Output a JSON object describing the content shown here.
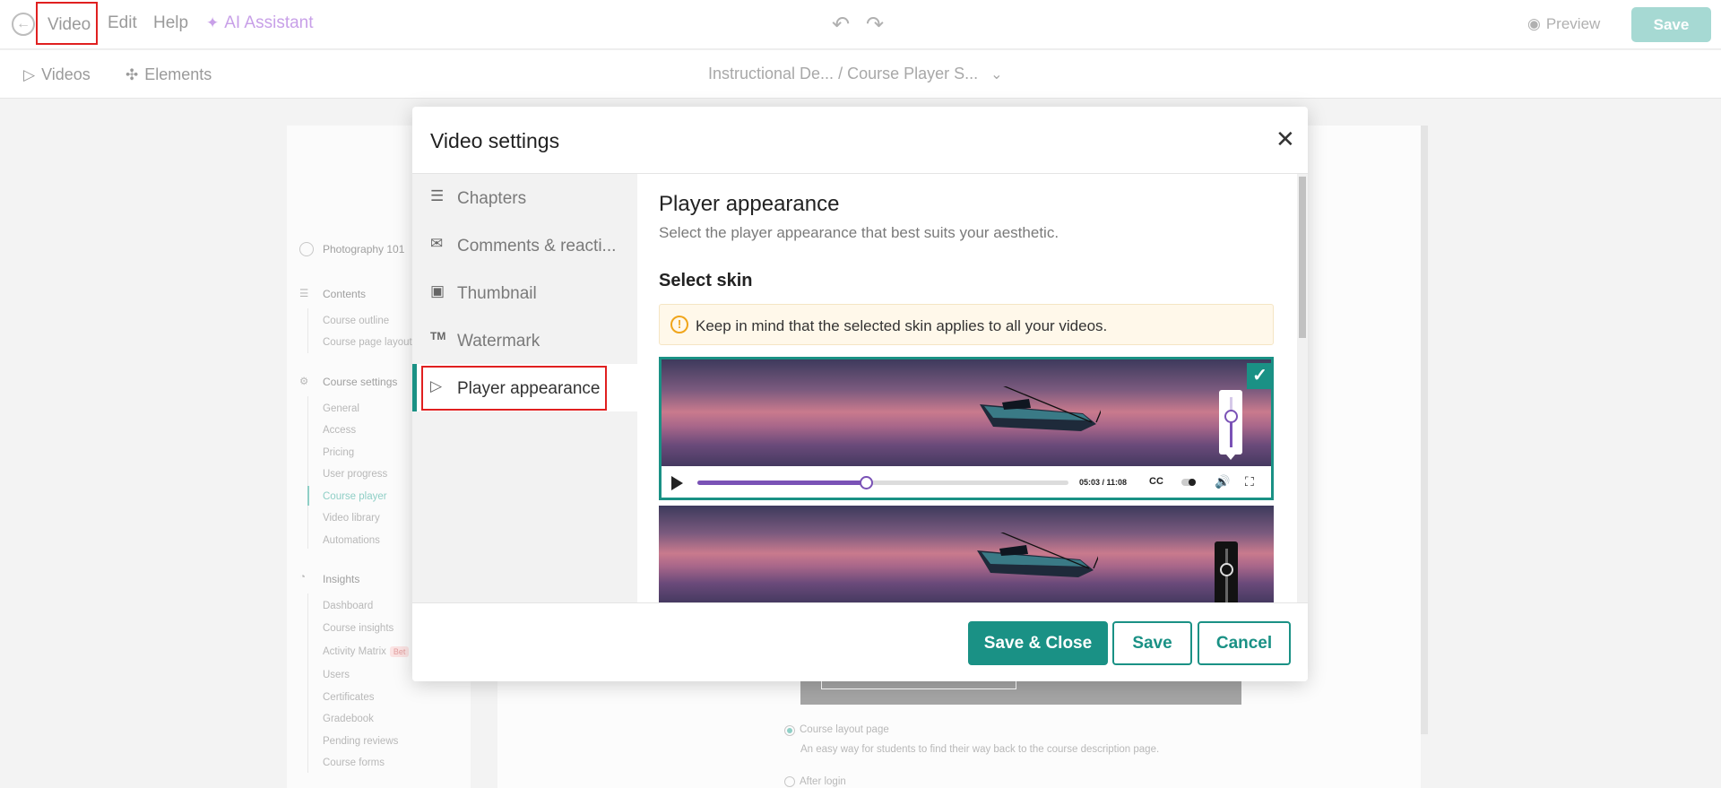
{
  "topbar": {
    "menu": {
      "video": "Video",
      "edit": "Edit",
      "help": "Help",
      "ai": "AI Assistant"
    },
    "preview_label": "Preview",
    "save_label": "Save"
  },
  "subbar": {
    "tab_videos": "Videos",
    "tab_elements": "Elements",
    "breadcrumb": "Instructional De...  / Course Player S..."
  },
  "background": {
    "course_title": "Photography 101",
    "contents_heading": "Contents",
    "contents_items": [
      "Course outline",
      "Course page layout"
    ],
    "settings_heading": "Course settings",
    "settings_items": [
      "General",
      "Access",
      "Pricing",
      "User progress",
      "Course player",
      "Video library",
      "Automations"
    ],
    "active_settings_item": "Course player",
    "insights_heading": "Insights",
    "insights_items": [
      "Dashboard",
      "Course insights",
      "Activity Matrix",
      "Users",
      "Certificates",
      "Gradebook",
      "Pending reviews",
      "Course forms"
    ],
    "beta_badge": "Bet",
    "radio_option_1_label": "Course layout page",
    "radio_option_1_desc": "An easy way for students to find their way back to the course description page.",
    "radio_option_2_label": "After login"
  },
  "modal": {
    "title": "Video settings",
    "nav": [
      {
        "label": "Chapters",
        "icon": "chapters-icon"
      },
      {
        "label": "Comments & reacti...",
        "icon": "comments-icon"
      },
      {
        "label": "Thumbnail",
        "icon": "thumbnail-icon"
      },
      {
        "label": "Watermark",
        "icon": "watermark-icon"
      },
      {
        "label": "Player appearance",
        "icon": "player-appearance-icon"
      }
    ],
    "active_nav": "Player appearance",
    "content": {
      "title": "Player appearance",
      "subtitle": "Select the player appearance that best suits your aesthetic.",
      "select_skin_heading": "Select skin",
      "notice": "Keep in mind that the selected skin applies to all your videos.",
      "skin1_time": "05:03 / 11:08",
      "skin1_cc": "CC",
      "skin1_progress_fraction": 0.455,
      "skin1_selected": true
    },
    "footer": {
      "save_close": "Save & Close",
      "save": "Save",
      "cancel": "Cancel"
    }
  },
  "colors": {
    "accent": "#1a9185",
    "skin_accent": "#7a52b6",
    "highlight": "#e02020",
    "warning": "#f0a51a"
  }
}
